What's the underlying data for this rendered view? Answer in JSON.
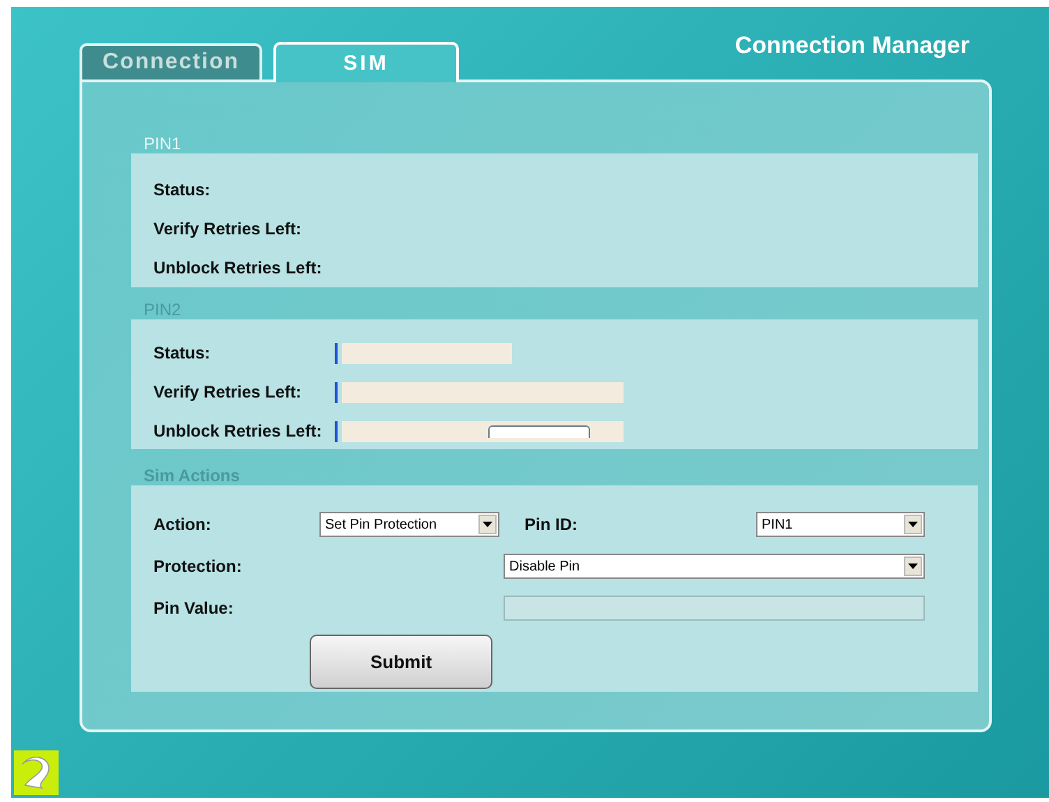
{
  "window": {
    "title": "Connection Manager"
  },
  "tabs": [
    {
      "label": "Connection",
      "selected": false
    },
    {
      "label": "SIM",
      "selected": true
    }
  ],
  "pin1": {
    "legend": "PIN1",
    "rows": [
      {
        "label": "Status:"
      },
      {
        "label": "Verify Retries Left:"
      },
      {
        "label": "Unblock Retries Left:"
      }
    ]
  },
  "pin2": {
    "legend": "PIN2",
    "rows": [
      {
        "label": "Status:"
      },
      {
        "label": "Verify Retries Left:"
      },
      {
        "label": "Unblock Retries Left:"
      }
    ]
  },
  "sim_actions": {
    "legend": "Sim Actions",
    "action": {
      "label": "Action:",
      "value": "Set Pin Protection"
    },
    "pin_id": {
      "label": "Pin ID:",
      "value": "PIN1"
    },
    "protection": {
      "label": "Protection:",
      "value": "Disable Pin"
    },
    "pin_value": {
      "label": "Pin Value:",
      "disabled": true
    },
    "submit": "Submit"
  }
}
